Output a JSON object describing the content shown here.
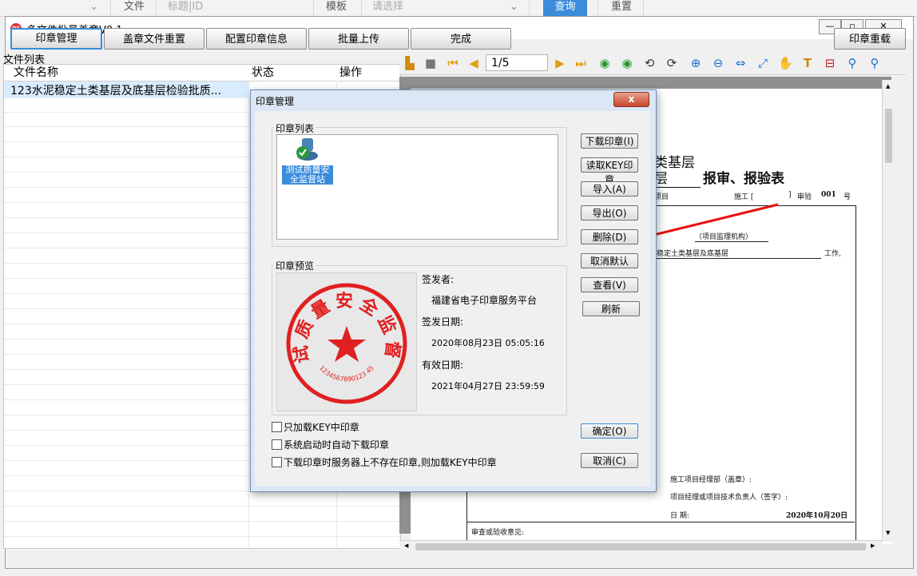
{
  "topbar": {
    "file_label": "文件",
    "title_placeholder": "标题|ID",
    "template_label": "模板",
    "template_placeholder": "请选择",
    "query_button": "查询",
    "reset_button": "重置"
  },
  "window": {
    "icon_text": "DX",
    "title": "多文件批量盖章V0.1"
  },
  "toolbar": {
    "seal_manage": "印章管理",
    "reset_files": "盖章文件重置",
    "config_seal": "配置印章信息",
    "batch_upload": "批量上传",
    "done": "完成",
    "reload_seal": "印章重载"
  },
  "file_list": {
    "label": "文件列表",
    "col_name": "文件名称",
    "col_status": "状态",
    "col_action": "操作",
    "rows": [
      {
        "name": "123水泥稳定土类基层及底基层检验批质..."
      }
    ]
  },
  "pdf_toolbar": {
    "page_indicator": "1/5"
  },
  "document": {
    "heading_part1": "类基层",
    "heading_part2": "层",
    "heading_part3": "报审、报验表",
    "line_project": "项目",
    "line_construction": "施工 [",
    "line_close_bracket": "]",
    "line_review": "审验",
    "line_number": "001",
    "line_hao": "号",
    "supervisor_org": "（项目监理机构）",
    "subject_text": "稳定土类基层及底基层",
    "work_text": "工作,",
    "sig_dept": "施工项目经理部（盖章）:",
    "sig_manager": "项目经理或项目技术负责人（签字）:",
    "sig_date_label": "日      期:",
    "sig_date_value": "2020年10月20日",
    "review_opinion": "审查或验收意见:"
  },
  "dialog": {
    "title": "印章管理",
    "close_glyph": "x",
    "seal_list_label": "印章列表",
    "seal_item_name": "测试质量安全监督站",
    "seal_preview_label": "印章预览",
    "seal_ring_text": "测试质量安全监督站",
    "seal_number": "1234567890123 45",
    "issuer_label": "签发者:",
    "issuer_value": "福建省电子印章服务平台",
    "issue_date_label": "签发日期:",
    "issue_date_value": "2020年08月23日 05:05:16",
    "valid_date_label": "有效日期:",
    "valid_date_value": "2021年04月27日 23:59:59",
    "btn_download": "下载印章(I)",
    "btn_read_key": "读取KEY印章",
    "btn_import": "导入(A)",
    "btn_export": "导出(O)",
    "btn_delete": "删除(D)",
    "btn_cancel_default": "取消默认",
    "btn_view": "查看(V)",
    "btn_refresh": "刷新",
    "btn_ok": "确定(O)",
    "btn_cancel": "取消(C)",
    "chk_only_key": "只加载KEY中印章",
    "chk_auto_download": "系统启动时自动下载印章",
    "chk_fallback_key": "下载印章时服务器上不存在印章,则加载KEY中印章"
  },
  "colors": {
    "accent": "#3b8cdb",
    "seal_red": "#e02020",
    "arrow_red": "#e81010",
    "dialog_frame": "#dbe7f5"
  }
}
